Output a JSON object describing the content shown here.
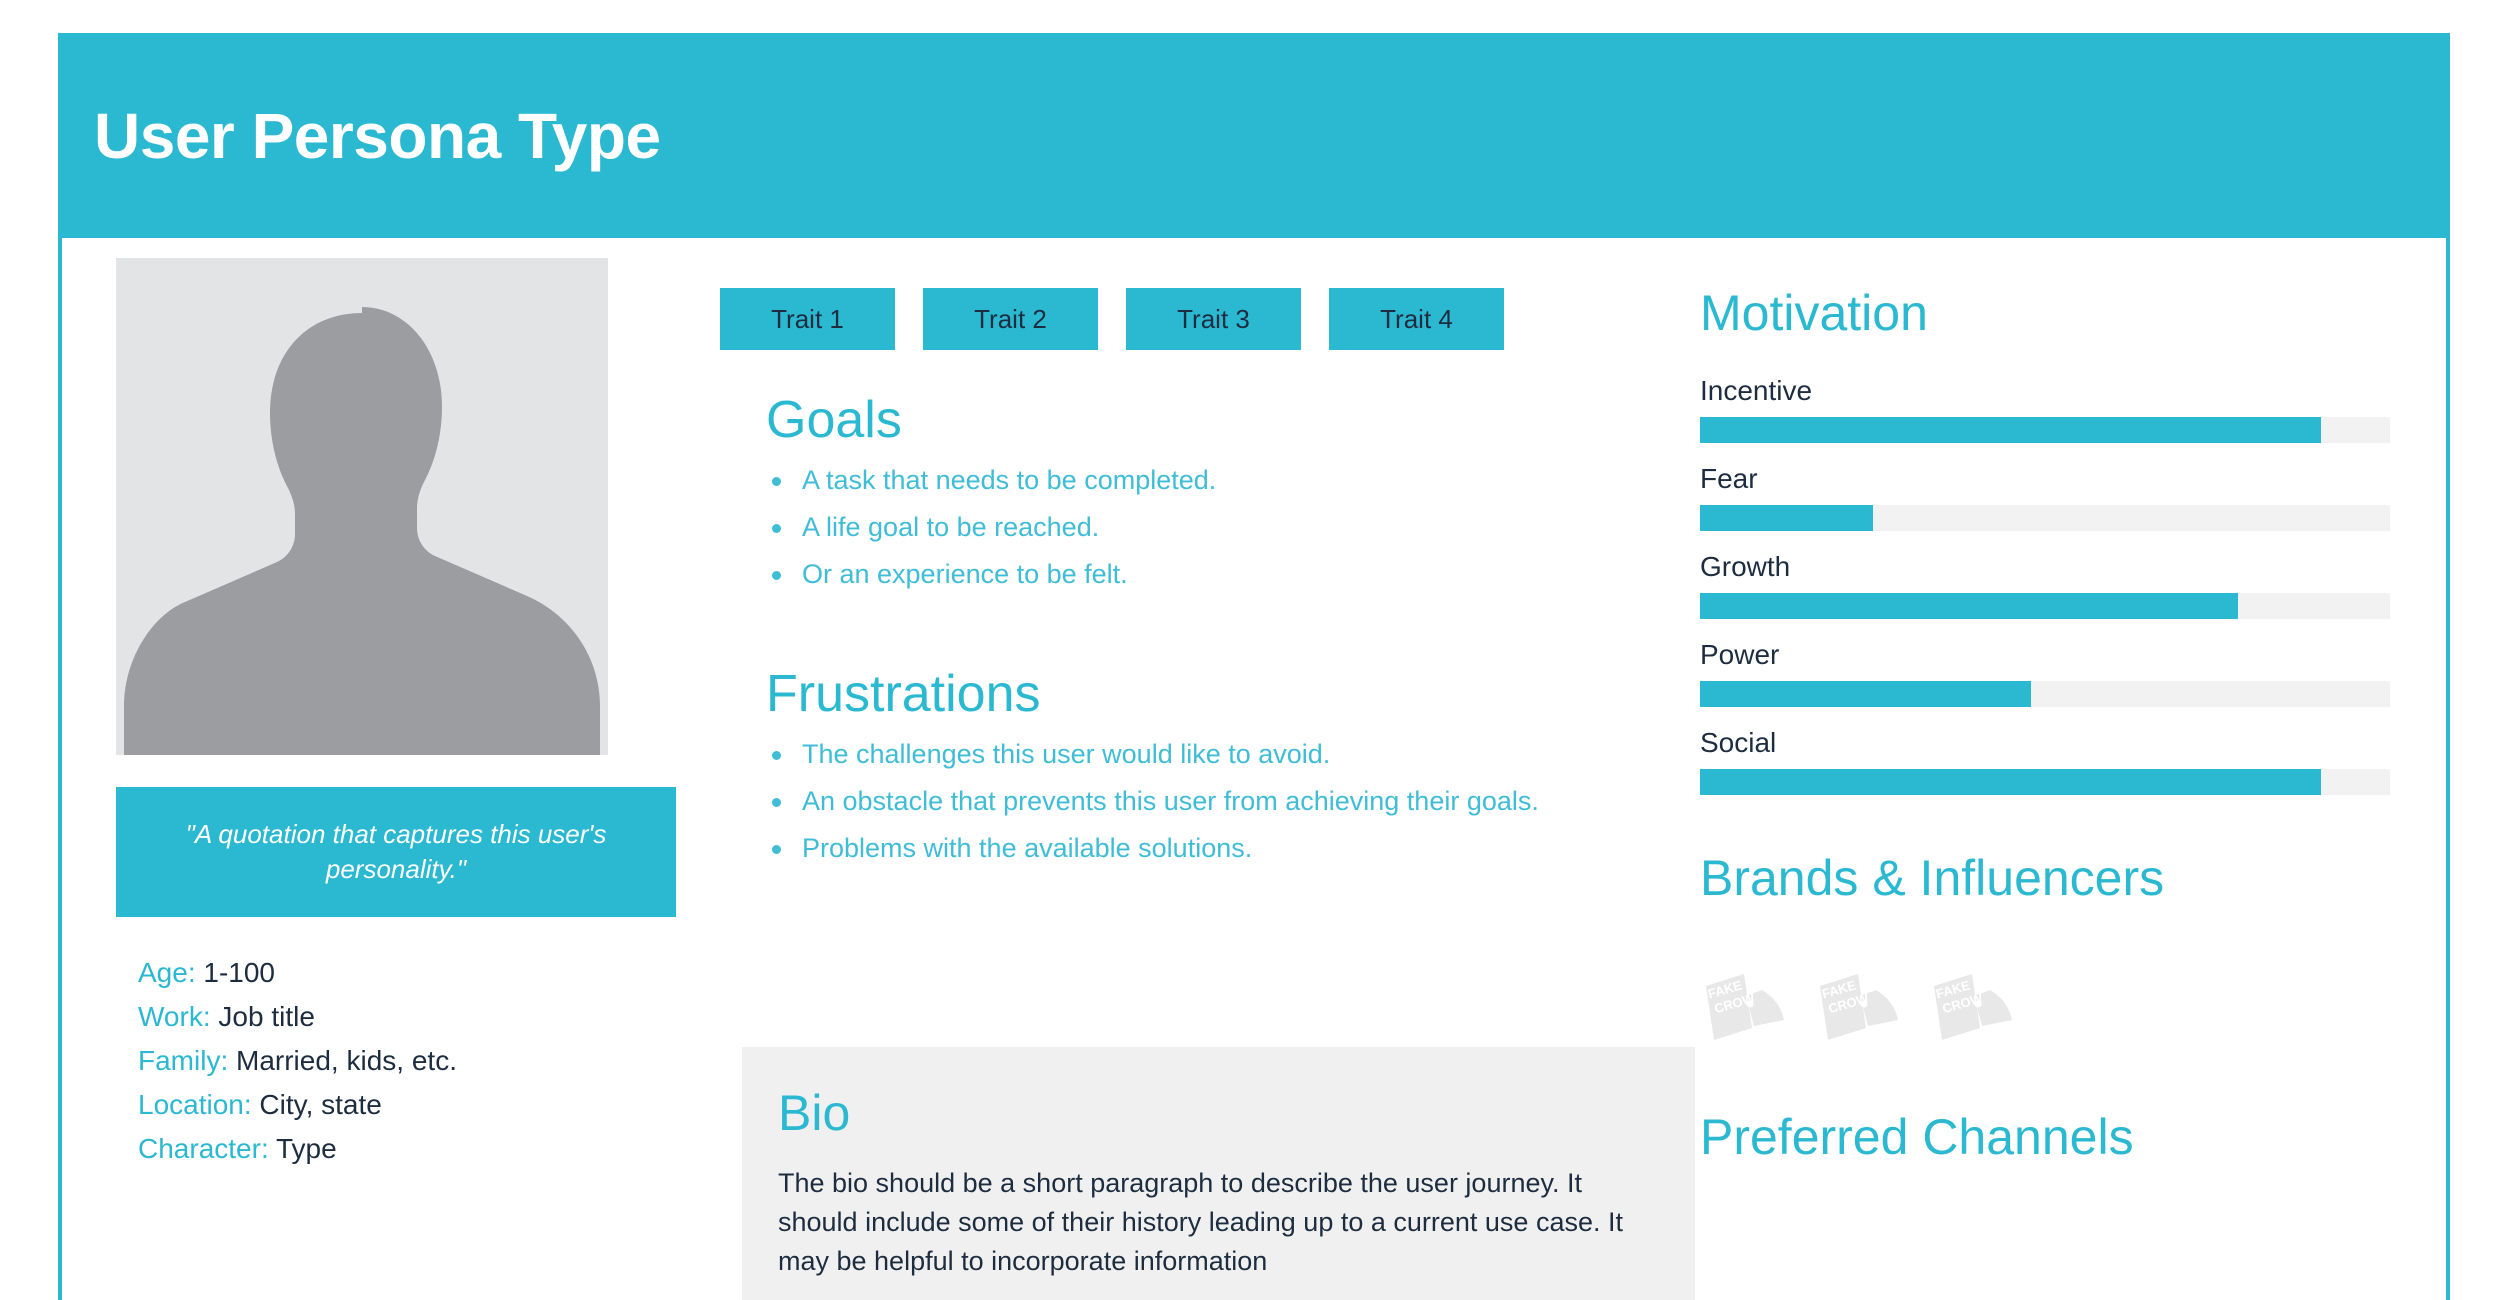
{
  "header": {
    "title": "User Persona Type"
  },
  "colors": {
    "accent": "#2bb8d1",
    "accent_light": "#3fbdd6",
    "text_dark": "#1d2d3f",
    "panel_bg": "#f0f0f0",
    "track_bg": "#f2f2f2",
    "avatar_bg": "#e3e4e6",
    "avatar_figure": "#9b9da0"
  },
  "left": {
    "avatar_alt": "person-placeholder-silhouette",
    "quote": "\"A quotation that captures this user's personality.\"",
    "demographics": [
      {
        "label": "Age:",
        "value": "1-100"
      },
      {
        "label": "Work:",
        "value": "Job title"
      },
      {
        "label": "Family:",
        "value": "Married, kids, etc."
      },
      {
        "label": "Location:",
        "value": "City, state"
      },
      {
        "label": "Character:",
        "value": "Type"
      }
    ]
  },
  "middle": {
    "traits": [
      "Trait 1",
      "Trait 2",
      "Trait 3",
      "Trait 4"
    ],
    "goals": {
      "title": "Goals",
      "items": [
        "A task that needs to be completed.",
        "A life goal to be reached.",
        "Or an experience to be felt."
      ]
    },
    "frustrations": {
      "title": "Frustrations",
      "items": [
        "The challenges this user would like to avoid.",
        "An obstacle that prevents this user from achieving their goals.",
        "Problems with the available solutions."
      ]
    },
    "bio": {
      "title": "Bio",
      "text": "The bio should be a short paragraph to describe the user journey. It should include some of their history leading up to a current use case. It may be helpful to incorporate information"
    }
  },
  "right": {
    "motivation": {
      "title": "Motivation",
      "bars": [
        {
          "label": "Incentive",
          "value": 90
        },
        {
          "label": "Fear",
          "value": 25
        },
        {
          "label": "Growth",
          "value": 78
        },
        {
          "label": "Power",
          "value": 48
        },
        {
          "label": "Social",
          "value": 90
        }
      ]
    },
    "brands": {
      "title": "Brands & Influencers",
      "logos": [
        {
          "line1": "FAKE",
          "line2": "CROW"
        },
        {
          "line1": "FAKE",
          "line2": "CROW"
        },
        {
          "line1": "FAKE",
          "line2": "CROW"
        }
      ]
    },
    "channels": {
      "title": "Preferred Channels"
    }
  }
}
